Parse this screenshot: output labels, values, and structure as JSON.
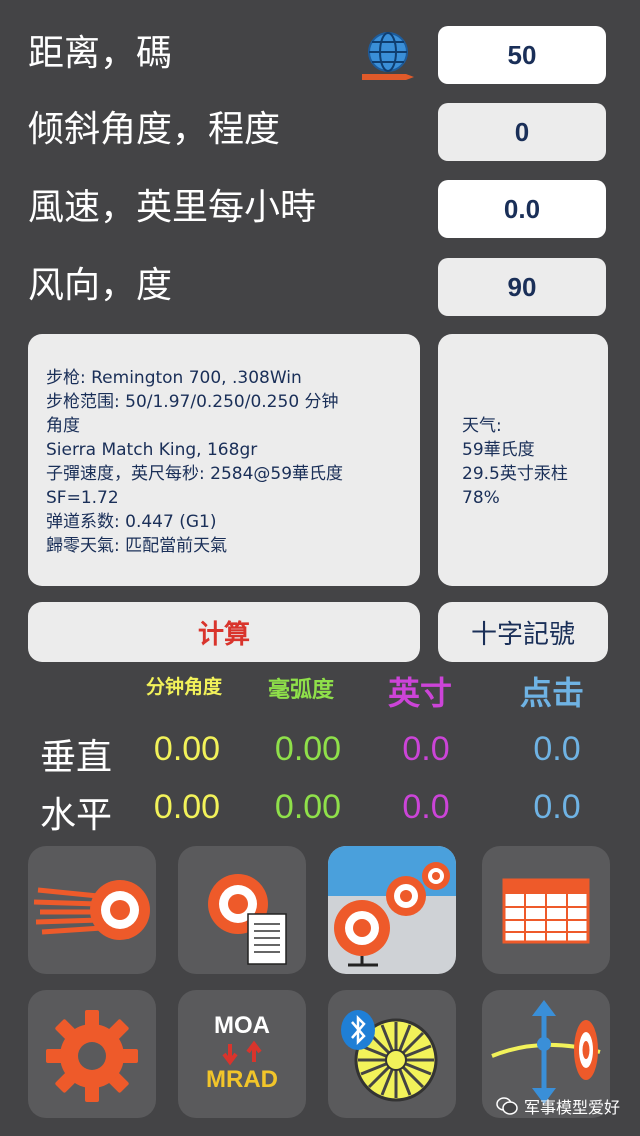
{
  "inputs": {
    "distance": {
      "label": "距离，碼",
      "value": "50"
    },
    "incline": {
      "label": "倾斜角度，程度",
      "value": "0"
    },
    "wind_speed": {
      "label": "風速，英里每小時",
      "value": "0.0"
    },
    "wind_direction": {
      "label": "风向，度",
      "value": "90"
    }
  },
  "rifle_info": [
    "步枪: Remington 700, .308Win",
    "步枪范围: 50/1.97/0.250/0.250 分钟",
    "角度",
    "Sierra Match King, 168gr",
    "子彈速度，英尺每秒: 2584@59華氏度",
    "SF=1.72",
    "弹道系数: 0.447 (G1)",
    "歸零天氣: 匹配當前天氣"
  ],
  "weather_info": [
    "天气:",
    "59華氏度",
    "29.5英寸汞柱",
    "78%"
  ],
  "buttons": {
    "calculate": "计算",
    "reticle": "十字記號"
  },
  "results": {
    "headers": {
      "moa": "分钟角度",
      "mrad": "毫弧度",
      "inch": "英寸",
      "click": "点击"
    },
    "vertical": {
      "label": "垂直",
      "moa": "0.00",
      "mrad": "0.00",
      "inch": "0.0",
      "click": "0.0"
    },
    "horizontal": {
      "label": "水平",
      "moa": "0.00",
      "mrad": "0.00",
      "inch": "0.0",
      "click": "0.0"
    }
  },
  "tiles": {
    "unit_top": "MOA",
    "unit_bottom": "MRAD"
  },
  "watermark": "军事模型爱好",
  "colors": {
    "moa": "#f2f25a",
    "mrad": "#8fe04a",
    "inch": "#cc44d8",
    "click": "#6fb3e4",
    "accent_orange": "#ee5a2a",
    "calc_red": "#d9342c",
    "navy": "#1a2f58"
  }
}
